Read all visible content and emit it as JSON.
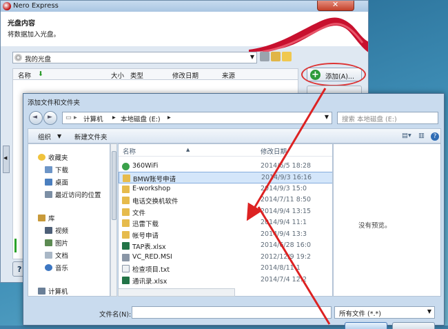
{
  "nero": {
    "title": "Nero Express",
    "header_title": "光盘内容",
    "header_subtitle": "将数据加入光盘。",
    "drive_label": "我的光盘",
    "columns": [
      "名称",
      "大小",
      "类型",
      "修改日期",
      "来源"
    ],
    "add_button": "添加(A)..."
  },
  "dialog": {
    "title": "添加文件和文件夹",
    "address": [
      "计算机",
      "本地磁盘 (E:)"
    ],
    "search_placeholder": "搜索 本地磁盘 (E:)",
    "organize": "组织",
    "new_folder": "新建文件夹",
    "nav_items": [
      {
        "label": "收藏夹",
        "icon": "star-icon"
      },
      {
        "label": "下载",
        "icon": "download-icon"
      },
      {
        "label": "桌面",
        "icon": "desktop-icon"
      },
      {
        "label": "最近访问的位置",
        "icon": "recent-icon"
      },
      {
        "label": "库",
        "icon": "library-icon"
      },
      {
        "label": "视频",
        "icon": "video-icon"
      },
      {
        "label": "图片",
        "icon": "picture-icon"
      },
      {
        "label": "文档",
        "icon": "document-icon"
      },
      {
        "label": "音乐",
        "icon": "music-icon"
      },
      {
        "label": "计算机",
        "icon": "computer-icon"
      }
    ],
    "file_columns": [
      "名称",
      "修改日期"
    ],
    "files": [
      {
        "name": "360WiFi",
        "date": "2014/6/5 18:28",
        "icon": "wifi-app-icon"
      },
      {
        "name": "BMW账号申请",
        "date": "2014/9/3 16:16",
        "icon": "folder-icon"
      },
      {
        "name": "E-workshop",
        "date": "2014/9/3 15:0",
        "icon": "folder-icon"
      },
      {
        "name": "电话交换机软件",
        "date": "2014/7/11 8:50",
        "icon": "folder-icon"
      },
      {
        "name": "文件",
        "date": "2014/9/4 13:15",
        "icon": "folder-icon"
      },
      {
        "name": "迅雷下载",
        "date": "2014/9/4 11:1",
        "icon": "folder-icon"
      },
      {
        "name": "帐号申请",
        "date": "2014/9/4 13:3",
        "icon": "folder-icon"
      },
      {
        "name": "TAP表.xlsx",
        "date": "2014/6/28 16:0",
        "icon": "excel-icon"
      },
      {
        "name": "VC_RED.MSI",
        "date": "2012/12/9 19:2",
        "icon": "msi-icon"
      },
      {
        "name": "检查项目.txt",
        "date": "2014/8/11 1",
        "icon": "text-file-icon"
      },
      {
        "name": "通讯录.xlsx",
        "date": "2014/7/4 12:2",
        "icon": "excel-icon"
      }
    ],
    "preview_text": "没有预览。",
    "file_name_label": "文件名(N):",
    "file_type_value": "所有文件 (*.*)"
  },
  "colors": {
    "accent_red": "#dd2222",
    "selection": "#d4e6fa",
    "add_green": "#2e9b3a"
  }
}
